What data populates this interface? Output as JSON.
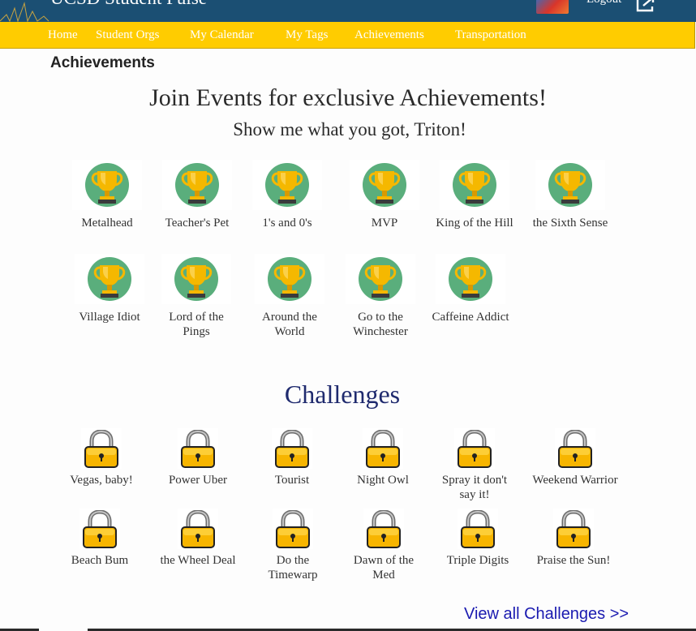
{
  "header": {
    "brand": "UCSD Student Pulse",
    "logout_label": "Logout"
  },
  "nav": {
    "items": [
      {
        "label": "Home"
      },
      {
        "label": "Student Orgs"
      },
      {
        "label": "My Calendar"
      },
      {
        "label": "My Tags"
      },
      {
        "label": "Achievements"
      },
      {
        "label": "Transportation"
      }
    ]
  },
  "page": {
    "title": "Achievements",
    "headline": "Join Events for exclusive Achievements!",
    "subhead": "Show me what you got, Triton!"
  },
  "achievements": [
    {
      "label": "Metalhead",
      "icon": "trophy-icon"
    },
    {
      "label": "Teacher's Pet",
      "icon": "trophy-icon"
    },
    {
      "label": "1's and 0's",
      "icon": "trophy-icon"
    },
    {
      "label": "MVP",
      "icon": "trophy-icon"
    },
    {
      "label": "King of the Hill",
      "icon": "trophy-icon"
    },
    {
      "label": "the Sixth Sense",
      "icon": "trophy-icon"
    },
    {
      "label": "Village Idiot",
      "icon": "trophy-icon"
    },
    {
      "label": "Lord of the Pings",
      "icon": "trophy-icon"
    },
    {
      "label": "Around the World",
      "icon": "trophy-icon"
    },
    {
      "label": "Go to the Winchester",
      "icon": "trophy-icon"
    },
    {
      "label": "Caffeine Addict",
      "icon": "trophy-icon"
    }
  ],
  "challenges_section": {
    "title": "Challenges",
    "view_all": "View all Challenges >>"
  },
  "challenges": [
    {
      "label": "Vegas, baby!",
      "icon": "lock-icon"
    },
    {
      "label": "Power Uber",
      "icon": "lock-icon"
    },
    {
      "label": "Tourist",
      "icon": "lock-icon"
    },
    {
      "label": "Night Owl",
      "icon": "lock-icon"
    },
    {
      "label": "Spray it don't say it!",
      "icon": "lock-icon"
    },
    {
      "label": "Weekend Warrior",
      "icon": "lock-icon"
    },
    {
      "label": "Beach Bum",
      "icon": "lock-icon"
    },
    {
      "label": "the Wheel Deal",
      "icon": "lock-icon"
    },
    {
      "label": "Do the Timewarp",
      "icon": "lock-icon"
    },
    {
      "label": "Dawn of the Med",
      "icon": "lock-icon"
    },
    {
      "label": "Triple Digits",
      "icon": "lock-icon"
    },
    {
      "label": "Praise the Sun!",
      "icon": "lock-icon"
    }
  ],
  "colors": {
    "header_bg": "#1b4f73",
    "nav_bg": "#ffcc00",
    "trophy_circle": "#5aae7c",
    "trophy_gold": "#f5b800",
    "lock_gold": "#f7b500",
    "challenges_title": "#1f2a6e",
    "link": "#1a1ab0"
  }
}
